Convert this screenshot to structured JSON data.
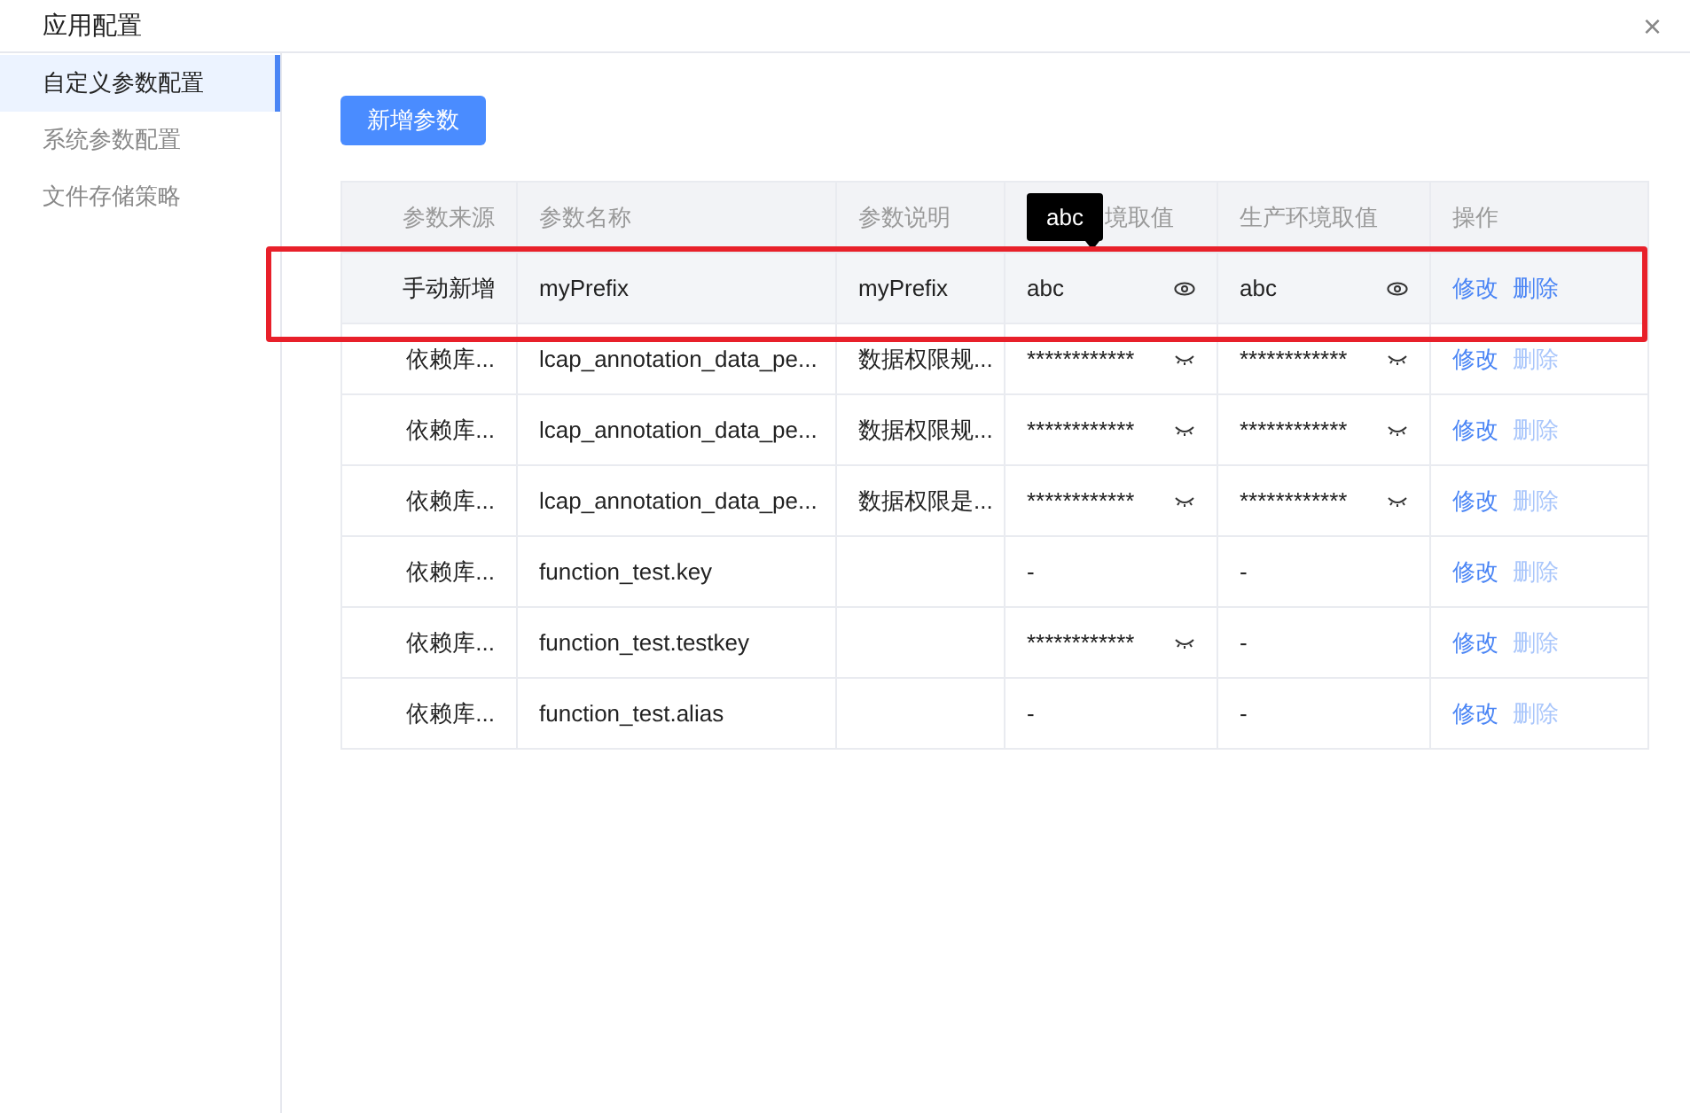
{
  "window": {
    "title": "应用配置",
    "close": "×"
  },
  "sidebar": {
    "items": [
      {
        "label": "自定义参数配置",
        "selected": true
      },
      {
        "label": "系统参数配置",
        "selected": false
      },
      {
        "label": "文件存储策略",
        "selected": false
      }
    ]
  },
  "add_button": "新增参数",
  "table": {
    "columns": [
      "参数来源",
      "参数名称",
      "参数说明",
      "境取值",
      "生产环境取值",
      "操作"
    ],
    "tooltip": "abc",
    "rows": [
      {
        "source": "手动新增",
        "name": "myPrefix",
        "description": "myPrefix",
        "dev": {
          "kind": "shown",
          "text": "abc"
        },
        "prod": {
          "kind": "shown",
          "text": "abc"
        },
        "edit": "修改",
        "delete": "删除",
        "delete_disabled": false,
        "hovered": true
      },
      {
        "source": "依赖库...",
        "name": "lcap_annotation_data_pe...",
        "description": "数据权限规...",
        "dev": {
          "kind": "hidden",
          "text": "************"
        },
        "prod": {
          "kind": "hidden",
          "text": "************"
        },
        "edit": "修改",
        "delete": "删除",
        "delete_disabled": true,
        "hovered": false
      },
      {
        "source": "依赖库...",
        "name": "lcap_annotation_data_pe...",
        "description": "数据权限规...",
        "dev": {
          "kind": "hidden",
          "text": "************"
        },
        "prod": {
          "kind": "hidden",
          "text": "************"
        },
        "edit": "修改",
        "delete": "删除",
        "delete_disabled": true,
        "hovered": false
      },
      {
        "source": "依赖库...",
        "name": "lcap_annotation_data_pe...",
        "description": "数据权限是...",
        "dev": {
          "kind": "hidden",
          "text": "************"
        },
        "prod": {
          "kind": "hidden",
          "text": "************"
        },
        "edit": "修改",
        "delete": "删除",
        "delete_disabled": true,
        "hovered": false
      },
      {
        "source": "依赖库...",
        "name": "function_test.key",
        "dev": {
          "kind": "empty",
          "text": "-"
        },
        "prod": {
          "kind": "empty",
          "text": "-"
        },
        "edit": "修改",
        "delete": "删除",
        "delete_disabled": true,
        "hovered": false
      },
      {
        "source": "依赖库...",
        "name": "function_test.testkey",
        "dev": {
          "kind": "hidden",
          "text": "************"
        },
        "prod": {
          "kind": "empty",
          "text": "-"
        },
        "edit": "修改",
        "delete": "删除",
        "delete_disabled": true,
        "hovered": false
      },
      {
        "source": "依赖库...",
        "name": "function_test.alias",
        "dev": {
          "kind": "empty",
          "text": "-"
        },
        "prod": {
          "kind": "empty",
          "text": "-"
        },
        "edit": "修改",
        "delete": "删除",
        "delete_disabled": true,
        "hovered": false
      }
    ]
  },
  "annotation": {
    "kind": "frame",
    "color": "#e8202a"
  }
}
